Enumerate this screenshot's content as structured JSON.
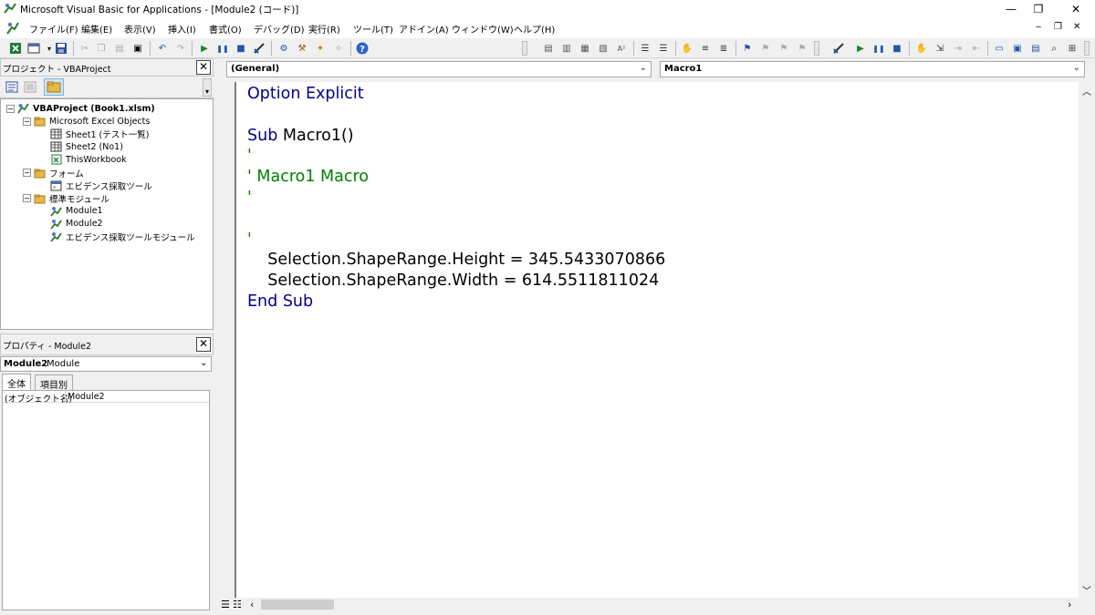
{
  "window": {
    "title": "Microsoft Visual Basic for Applications - [Module2 (コード)]",
    "controls": {
      "minimize": "—",
      "restore": "❐",
      "close": "✕"
    }
  },
  "menubar": {
    "items": [
      {
        "label": "ファイル(F)"
      },
      {
        "label": "編集(E)"
      },
      {
        "label": "表示(V)"
      },
      {
        "label": "挿入(I)"
      },
      {
        "label": "書式(O)"
      },
      {
        "label": "デバッグ(D)"
      },
      {
        "label": "実行(R)"
      },
      {
        "label": "ツール(T)"
      },
      {
        "label": "アドイン(A)"
      },
      {
        "label": "ウィンドウ(W)"
      },
      {
        "label": "ヘルプ(H)"
      }
    ],
    "mdi_controls": {
      "minimize": "‒",
      "restore": "❐",
      "close": "✕"
    }
  },
  "project_pane": {
    "title": "プロジェクト - VBAProject",
    "close": "✕",
    "tree": [
      {
        "label": "VBAProject (Book1.xlsm)",
        "level": 0,
        "expanded": true,
        "icon": "vba-project-icon",
        "bold": true
      },
      {
        "label": "Microsoft Excel Objects",
        "level": 1,
        "expanded": true,
        "icon": "folder-icon"
      },
      {
        "label": "Sheet1 (テスト一覧)",
        "level": 2,
        "icon": "sheet-icon"
      },
      {
        "label": "Sheet2 (No1)",
        "level": 2,
        "icon": "sheet-icon"
      },
      {
        "label": "ThisWorkbook",
        "level": 2,
        "icon": "workbook-icon"
      },
      {
        "label": "フォーム",
        "level": 1,
        "expanded": true,
        "icon": "folder-icon"
      },
      {
        "label": "エビデンス採取ツール",
        "level": 2,
        "icon": "form-icon"
      },
      {
        "label": "標準モジュール",
        "level": 1,
        "expanded": true,
        "icon": "folder-icon"
      },
      {
        "label": "Module1",
        "level": 2,
        "icon": "module-icon"
      },
      {
        "label": "Module2",
        "level": 2,
        "icon": "module-icon"
      },
      {
        "label": "エビデンス採取ツールモジュール",
        "level": 2,
        "icon": "module-icon"
      }
    ]
  },
  "properties_pane": {
    "title": "プロパティ - Module2",
    "close": "✕",
    "object_name": "Module2",
    "object_type": "Module",
    "tabs": [
      {
        "label": "全体",
        "active": true
      },
      {
        "label": "項目別",
        "active": false
      }
    ],
    "rows": [
      {
        "name": "(オブジェクト名)",
        "value": "Module2"
      }
    ]
  },
  "code_window": {
    "object_combo": "(General)",
    "procedure_combo": "Macro1",
    "lines": [
      {
        "text": "Option Explicit",
        "style": "kw"
      },
      {
        "text": "",
        "style": "plain"
      },
      {
        "text": "Sub Macro1()",
        "style": "mixed",
        "kw": "Sub",
        "rest": " Macro1()"
      },
      {
        "text": "'",
        "style": "cm"
      },
      {
        "text": "' Macro1 Macro",
        "style": "cm"
      },
      {
        "text": "'",
        "style": "cm"
      },
      {
        "text": "",
        "style": "plain"
      },
      {
        "text": "'",
        "style": "cm"
      },
      {
        "text": "    Selection.ShapeRange.Height = 345.5433070866",
        "style": "plain"
      },
      {
        "text": "    Selection.ShapeRange.Width = 614.5511811024",
        "style": "plain"
      },
      {
        "text": "End Sub",
        "style": "kw"
      }
    ]
  },
  "colors": {
    "keyword": "#00008b",
    "comment": "#008000",
    "text": "#000000"
  }
}
